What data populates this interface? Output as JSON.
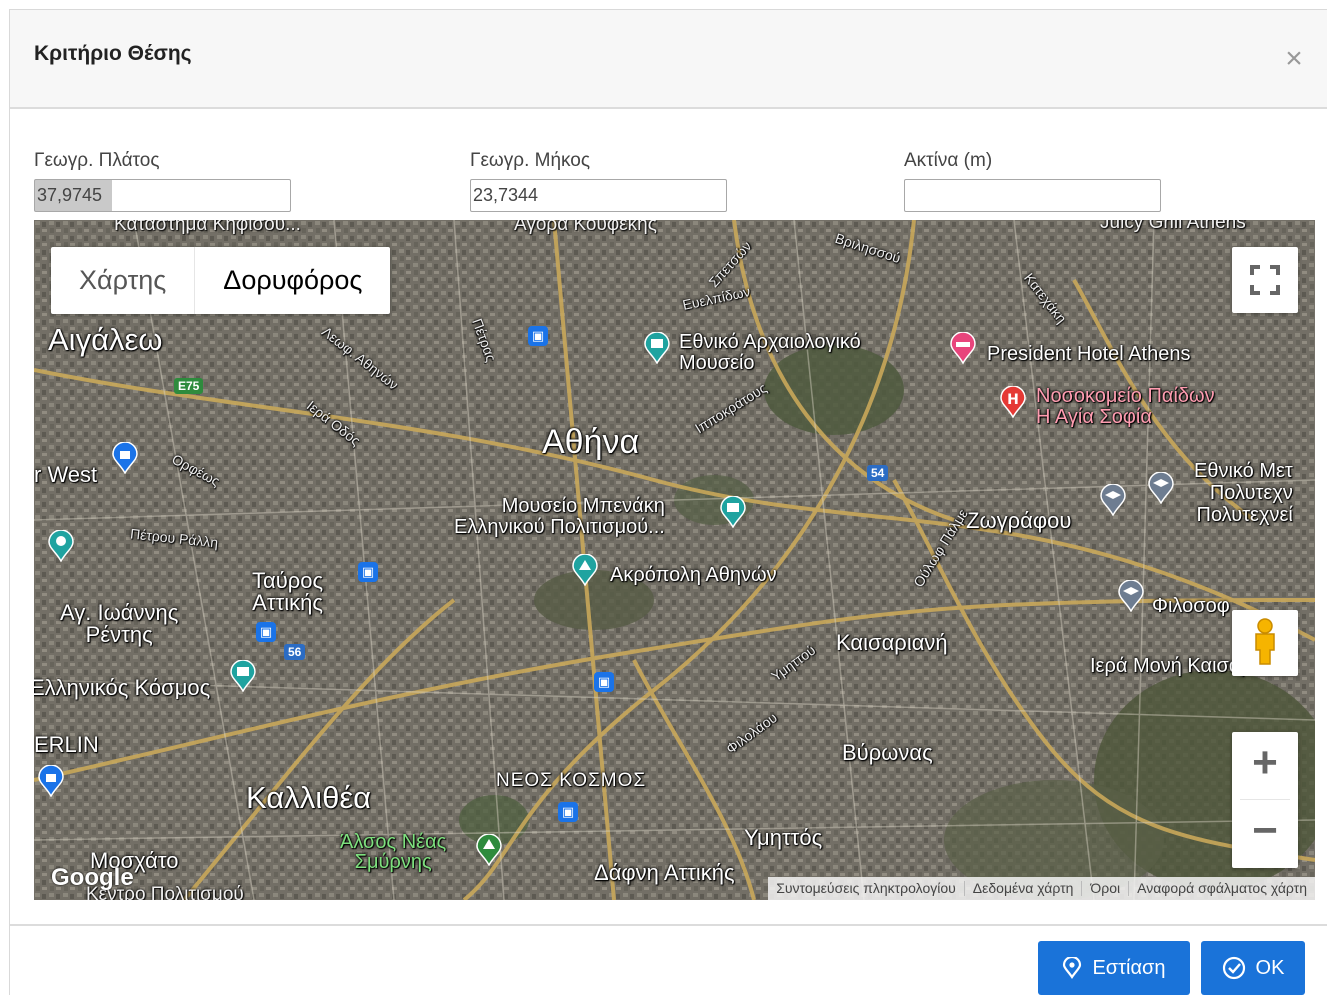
{
  "dialog": {
    "title": "Κριτήριο Θέσης",
    "close_symbol": "×"
  },
  "fields": {
    "latitude": {
      "label": "Γεωγρ. Πλάτος",
      "value": "37,9745"
    },
    "longitude": {
      "label": "Γεωγρ. Μήκος",
      "value": "23,7344"
    },
    "radius": {
      "label": "Ακτίνα (m)",
      "value": ""
    }
  },
  "map": {
    "map_type": {
      "map": "Χάρτης",
      "satellite": "Δορυφόρος",
      "selected": "Δορυφόρος"
    },
    "labels": {
      "athens": "Αθήνα",
      "aigaleo": "Αιγάλεω",
      "kallithea": "Καλλιθέα",
      "tavros": "Ταύρος\nΑττικής",
      "tavros_1": "Ταύρος",
      "tavros_2": "Αττικής",
      "ag_ioannis_1": "Αγ. Ιωάννης",
      "ag_ioannis_2": "Ρέντης",
      "kaisariani": "Καισαριανή",
      "zografou": "Ζωγράφου",
      "vyronas": "Βύρωνας",
      "ymittos": "Υμηττός",
      "neos_kosmos": "ΝΕΟΣ ΚΟΣΜΟΣ",
      "museum_1": "Εθνικό Αρχαιολογικό",
      "museum_2": "Μουσείο",
      "benaki_1": "Μουσείο Μπενάκη",
      "benaki_2": "Ελληνικού Πολιτισμού...",
      "acropolis": "Ακρόπολη Αθηνών",
      "president_hotel": "President Hotel Athens",
      "hospital_1": "Νοσοκομείο Παίδων",
      "hospital_2": "Η Αγία Σοφία",
      "polytechnic_1": "Εθνικό Μετ",
      "polytechnic_2": "Πολυτεχν",
      "polytechnic_3": "Πολυτεχνεί",
      "philosophy": "Φιλοσοφ",
      "moni_kaisarianis": "Ιερά Μονή Καισαριαν",
      "alsos_1": "Άλσος Νέας",
      "alsos_2": "Σμύρνης",
      "dafni": "Δάφνη Αττικής",
      "ellinikos_kosmos": "Ελληνικός Κόσμος",
      "moschato": "Μοσχάτο",
      "kentro": "Κέντρο Πολιτισμού",
      "west": "r West",
      "berlin": "ERLIN",
      "agora": "Αγορά Κουφέκης",
      "katastima": "Κατάστημα Κηφισού...",
      "juicy": "Juicy Grill Athens"
    },
    "roads": {
      "e75": "E75",
      "r54": "54",
      "r56": "56",
      "athinon": "Λεωφ. Αθηνών",
      "iera_odos": "Ιερά Οδός",
      "orfeos": "Ορφέως",
      "petrou_ralli": "Πέτρου Ράλλη",
      "petras": "Πέτρας",
      "ippokratous": "Ιπποκράτους",
      "katehaki": "Κατεχάκη",
      "ymittou": "Υμηττού",
      "filolaou": "Φιλολάου",
      "olof_palme": "Ούλωφ Πάλμε",
      "evelpidon": "Ευελπίδων",
      "spetson": "Σπετσών",
      "vrilissou": "Βριλησσού"
    },
    "google_logo": "Google",
    "attribution": {
      "shortcuts": "Συντομεύσεις πληκτρολογίου",
      "map_data": "Δεδομένα χάρτη",
      "terms": "Όροι",
      "report": "Αναφορά σφάλματος χάρτη"
    },
    "controls": {
      "zoom_in": "+",
      "zoom_out": "−"
    }
  },
  "footer": {
    "focus_label": "Εστίαση",
    "ok_label": "OK"
  },
  "colors": {
    "primary": "#1a73d9",
    "poi_teal": "#1fa3a0",
    "poi_blue": "#1a73e8",
    "poi_pink": "#e8457c",
    "poi_red": "#e53935"
  }
}
